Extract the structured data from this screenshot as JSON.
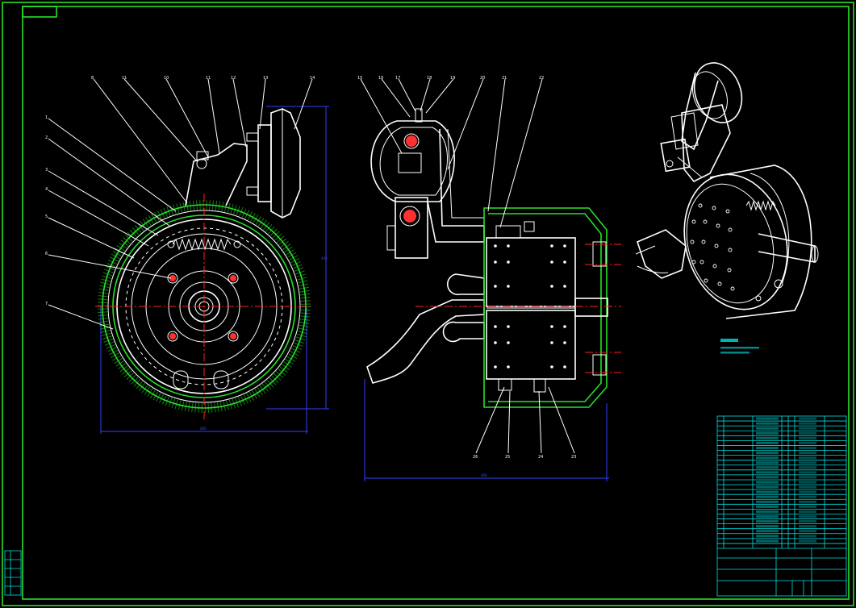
{
  "drawing": {
    "colors": {
      "background": "#000000",
      "frame": "#28e028",
      "outline": "#ffffff",
      "dimension": "#3040ff",
      "centerline": "#ff2020",
      "table": "#00e0e0"
    },
    "left_view_callouts": [
      "8",
      "11",
      "10",
      "11",
      "12",
      "13",
      "14",
      "1",
      "2",
      "3",
      "4",
      "5",
      "6",
      "7"
    ],
    "middle_view_top_callouts": [
      "15",
      "16",
      "17",
      "18",
      "19",
      "20",
      "21",
      "22"
    ],
    "middle_view_bottom_callouts": [
      "26",
      "25",
      "24",
      "23"
    ],
    "dimension_labels": {
      "left_width": "400",
      "left_height": "400",
      "middle_width": "400"
    }
  }
}
